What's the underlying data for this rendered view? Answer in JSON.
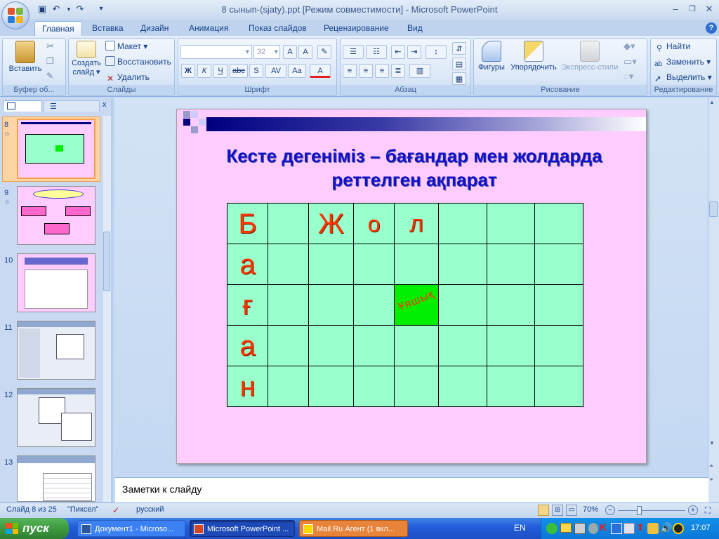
{
  "window": {
    "title": "8 сынып-(sjaty).ppt [Режим совместимости] - Microsoft PowerPoint"
  },
  "tabs": [
    "Главная",
    "Вставка",
    "Дизайн",
    "Анимация",
    "Показ слайдов",
    "Рецензирование",
    "Вид"
  ],
  "active_tab": "Главная",
  "ribbon": {
    "clipboard": {
      "paste": "Вставить",
      "label": "Буфер об..."
    },
    "slides": {
      "create_line1": "Создать",
      "create_line2": "слайд ▾",
      "layout": "Макет ▾",
      "reset": "Восстановить",
      "delete": "Удалить",
      "label": "Слайды"
    },
    "font": {
      "size": "32",
      "label": "Шрифт"
    },
    "paragraph": {
      "label": "Абзац"
    },
    "drawing": {
      "shapes": "Фигуры",
      "arrange": "Упорядочить",
      "styles": "Экспресс-стили",
      "label": "Рисование"
    },
    "editing": {
      "find": "Найти",
      "replace": "Заменить ▾",
      "select": "Выделить ▾",
      "label": "Редактирование"
    }
  },
  "thumbnails": [
    {
      "num": "8",
      "selected": true
    },
    {
      "num": "9",
      "selected": false
    },
    {
      "num": "10",
      "selected": false
    },
    {
      "num": "11",
      "selected": false
    },
    {
      "num": "12",
      "selected": false
    },
    {
      "num": "13",
      "selected": false
    }
  ],
  "slide": {
    "title_line1": "Кесте дегеніміз – бағандар мен жолдарда",
    "title_line2": "реттелген ақпарат",
    "row_letters": [
      "Б",
      "а",
      "ғ",
      "а",
      "н"
    ],
    "col_letters": [
      "Ж",
      "о",
      "л"
    ],
    "cell_word": "Ұяшық",
    "cell_color": "#00ee00",
    "grid_color": "#99ffcc",
    "background": "#ffccff"
  },
  "notes": {
    "placeholder": "Заметки к слайду"
  },
  "status": {
    "slide_info": "Слайд 8 из 25",
    "theme": "\"Пиксел\"",
    "language": "русский",
    "zoom": "70%"
  },
  "taskbar": {
    "start": "пуск",
    "items": [
      "Документ1 - Microso...",
      "Microsoft PowerPoint ...",
      "Mail.Ru Агент (1 вкл..."
    ],
    "lang": "EN",
    "clock": "17:07"
  }
}
